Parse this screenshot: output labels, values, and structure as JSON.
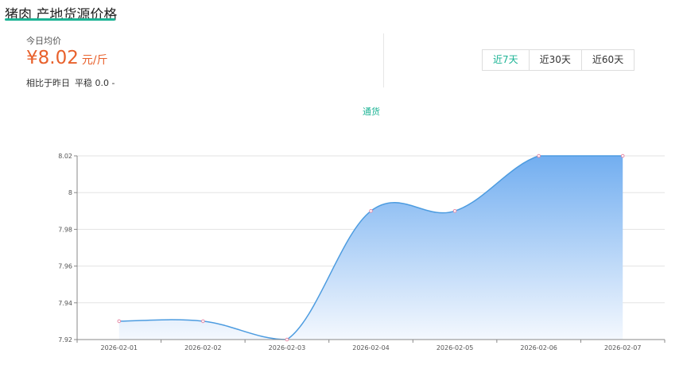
{
  "header": {
    "title": "猪肉 产地货源价格"
  },
  "summary": {
    "today_label": "今日均价",
    "price": "¥8.02",
    "unit": "元/斤",
    "compare_label": "相比于昨日",
    "compare_value": "平稳 0.0 -"
  },
  "range_tabs": [
    {
      "label": "近7天",
      "active": true
    },
    {
      "label": "近30天",
      "active": false
    },
    {
      "label": "近60天",
      "active": false
    }
  ],
  "colors": {
    "accent": "#1bb394",
    "price": "#e8612c",
    "line": "#4d9ce0",
    "area_top": "#72aef0",
    "area_bottom": "#f4f8fe",
    "point": "#e88ca8"
  },
  "chart_data": {
    "type": "area",
    "legend": [
      "通货"
    ],
    "legend_position": "top-center",
    "x": [
      "2026-02-01",
      "2026-02-02",
      "2026-02-03",
      "2026-02-04",
      "2026-02-05",
      "2026-02-06",
      "2026-02-07"
    ],
    "series": [
      {
        "name": "通货",
        "values": [
          7.93,
          7.93,
          7.92,
          7.99,
          7.99,
          8.02,
          8.02
        ]
      }
    ],
    "yticks": [
      "7.92",
      "7.94",
      "7.96",
      "7.98",
      "8",
      "8.02"
    ],
    "ylim": [
      7.92,
      8.02
    ],
    "grid": true,
    "smooth": true
  }
}
